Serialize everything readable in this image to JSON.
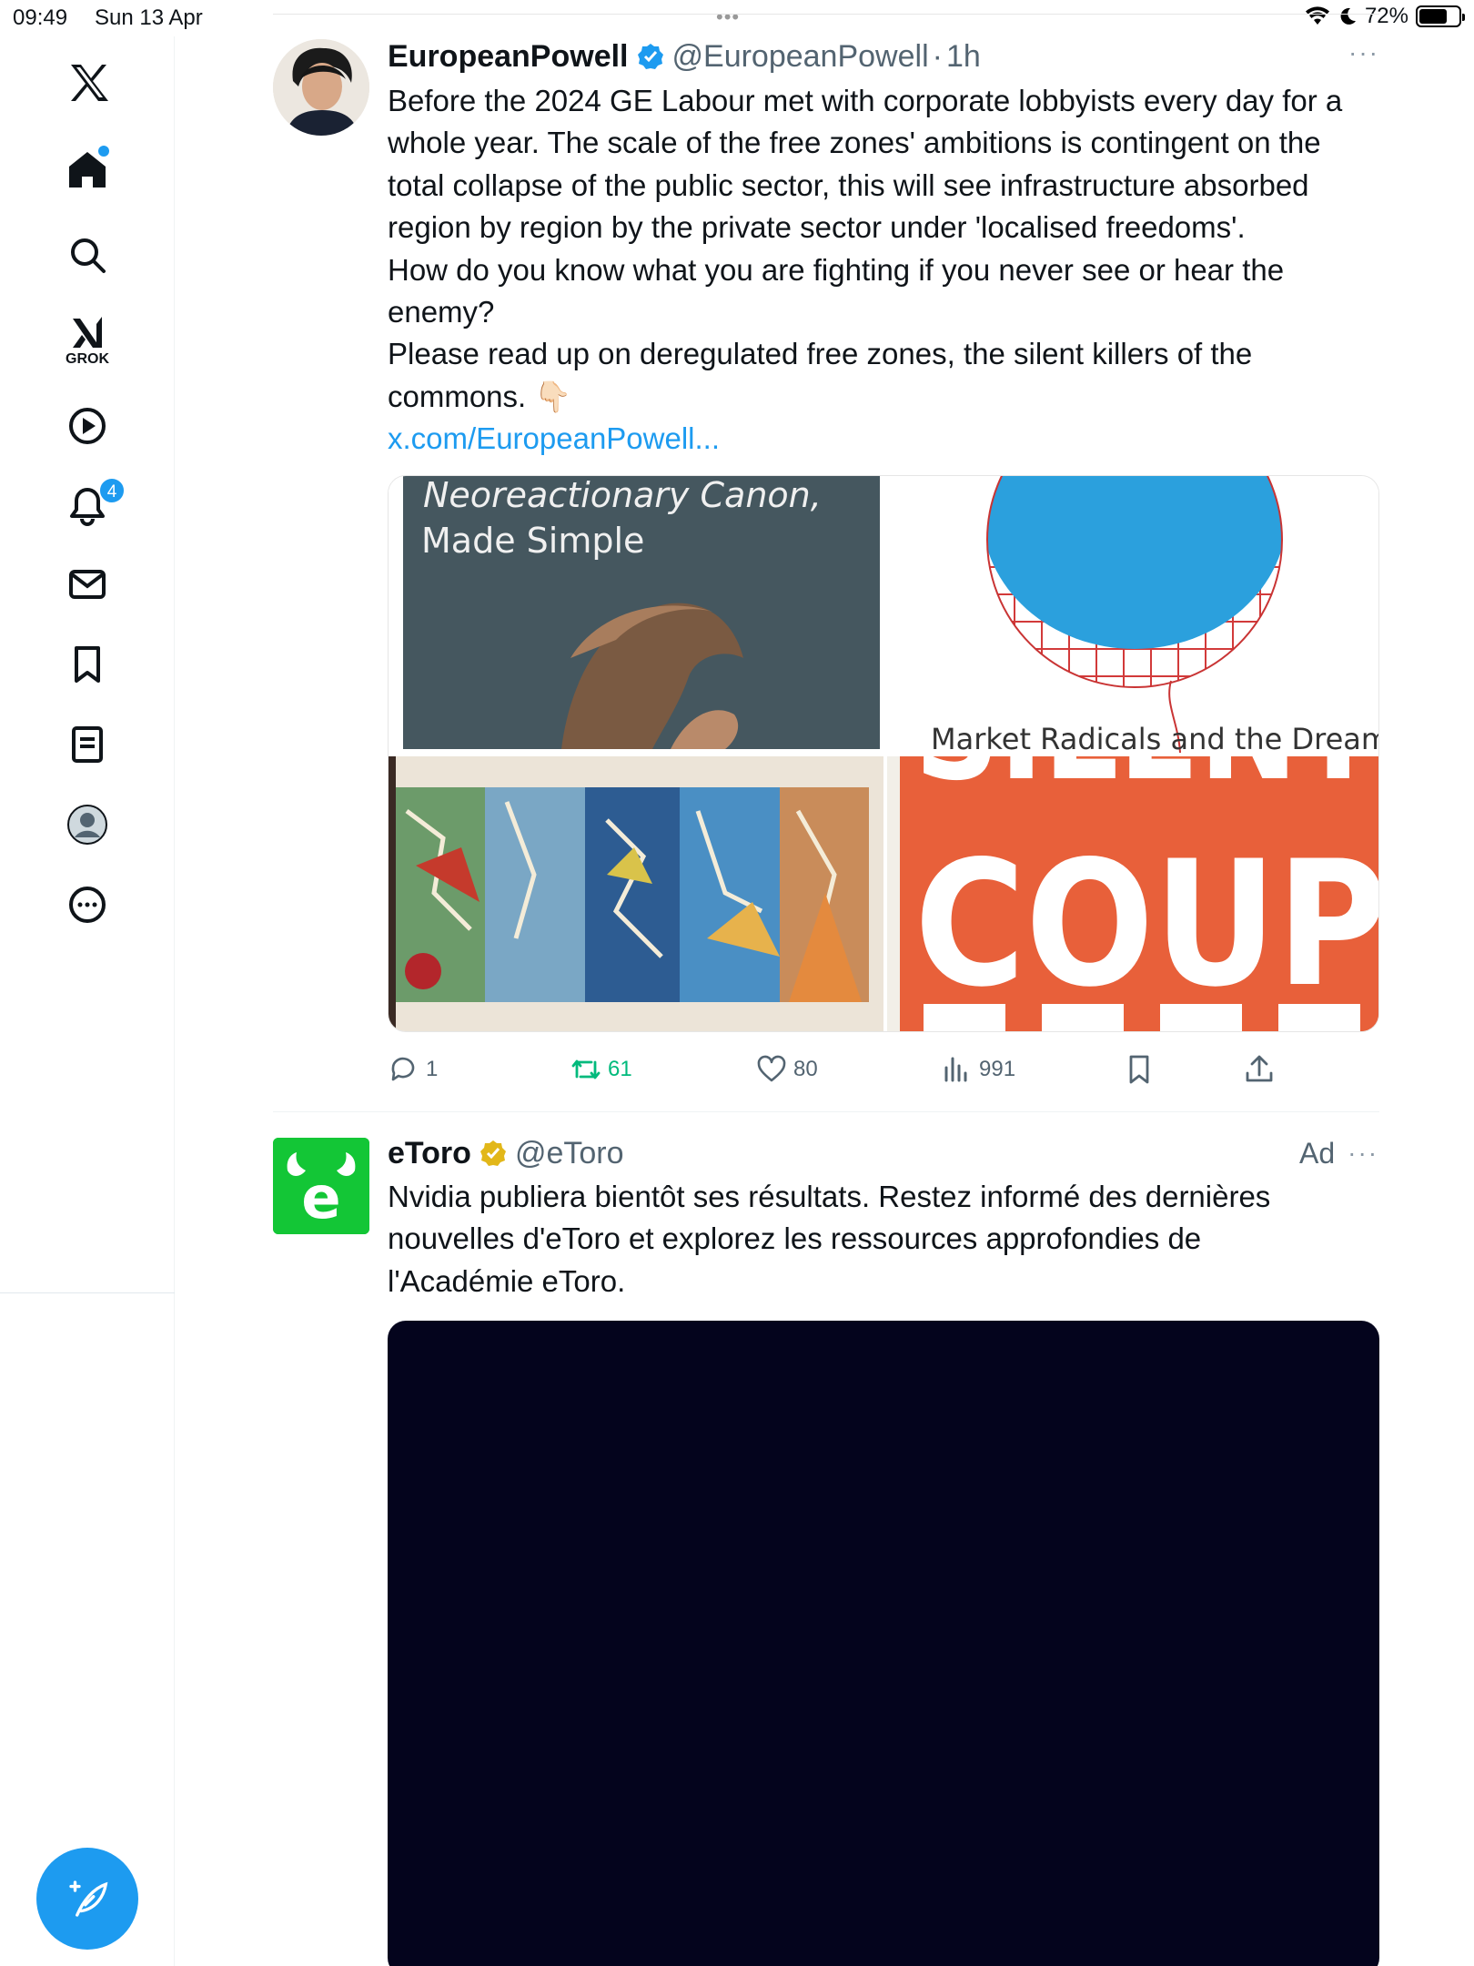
{
  "status_bar": {
    "time": "09:49",
    "date": "Sun 13 Apr",
    "battery": "72%",
    "battery_level": 0.72,
    "dots": "•••"
  },
  "sidebar": {
    "items": [
      {
        "name": "x-logo",
        "label": ""
      },
      {
        "name": "home",
        "label": ""
      },
      {
        "name": "search",
        "label": ""
      },
      {
        "name": "grok",
        "label": "GROK"
      },
      {
        "name": "video",
        "label": ""
      },
      {
        "name": "notifications",
        "label": "",
        "badge": "4"
      },
      {
        "name": "messages",
        "label": ""
      },
      {
        "name": "bookmarks",
        "label": ""
      },
      {
        "name": "lists",
        "label": ""
      },
      {
        "name": "profile",
        "label": ""
      },
      {
        "name": "more",
        "label": ""
      }
    ],
    "accent": "#1d9bf0"
  },
  "tweet": {
    "name": "EuropeanPowell",
    "handle": "@EuropeanPowell",
    "separator": "·",
    "time": "1h",
    "more": "···",
    "lines": [
      "Before the 2024 GE Labour met with corporate lobbyists every day for a",
      "whole year. The scale of the free zones' ambitions is contingent on the",
      "total collapse of the public sector, this will see infrastructure absorbed",
      "region by region by the private sector under 'localised freedoms'.",
      "How do you know what you are fighting if you never see or hear the",
      "enemy?",
      "Please read up on deregulated free zones, the silent killers of the",
      "commons. 👇🏻"
    ],
    "link": "x.com/EuropeanPowell...",
    "images": {
      "img1_title_line1": "Neoreactionary Canon,",
      "img1_title_line2": "Made Simple",
      "img2_caption": "Market Radicals and the Dream of",
      "img4_text_top": "SILENT",
      "img4_text_main": "COUP"
    },
    "actions": {
      "replies": "1",
      "retweets": "61",
      "likes": "80",
      "views": "991"
    },
    "retweet_color": "#00ba7c"
  },
  "ad": {
    "name": "eToro",
    "handle": "@eToro",
    "label": "Ad",
    "more": "···",
    "lines": [
      "Nvidia publiera bientôt ses résultats. Restez informé des dernières",
      "nouvelles d'eToro et explorez les ressources approfondies de",
      "l'Académie eToro."
    ],
    "brand_color": "#13c636",
    "logo_letter": "e"
  }
}
